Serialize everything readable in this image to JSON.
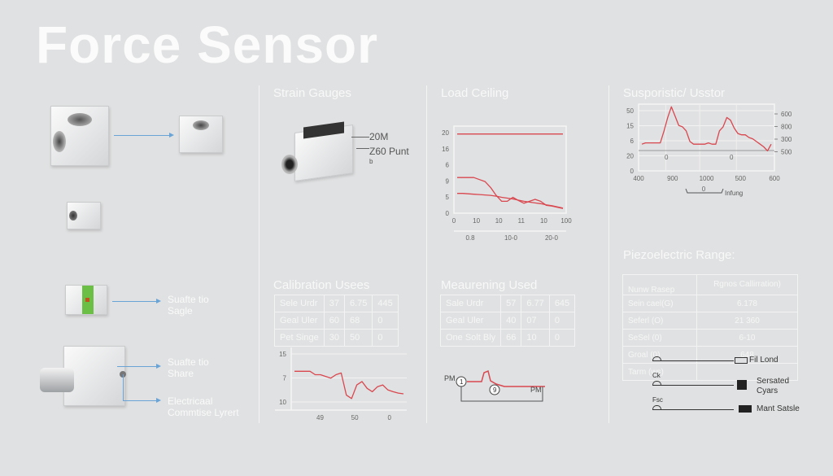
{
  "title": "Force Sensor",
  "left": {
    "callouts": [
      {
        "line1": "Suafte tio",
        "line2": "Sagle"
      },
      {
        "line1": "Suafte tio",
        "line2": "Share"
      },
      {
        "line1": "Electricaal",
        "line2": "Commtise Lyrert"
      }
    ]
  },
  "strain": {
    "heading": "Strain Gauges",
    "label_1": "20M",
    "label_2": "Z60 Punt",
    "label_3": "b"
  },
  "calibration": {
    "heading": "Calibration Usees",
    "rows": [
      [
        "Sele Urdr",
        "37",
        "6.75",
        "445"
      ],
      [
        "Geal Uler",
        "60",
        "68",
        "0"
      ],
      [
        "Pet Singe",
        "30",
        "50",
        "0"
      ]
    ]
  },
  "measuring": {
    "heading": "Meaurening Used",
    "rows": [
      [
        "Sale Urdr",
        "57",
        "6.77",
        "645"
      ],
      [
        "Geal Uler",
        "40",
        "07",
        "0"
      ],
      [
        "One Solt Bly",
        "66",
        "10",
        "0"
      ]
    ],
    "circuit": {
      "left_label": "PM",
      "right_label": "PM",
      "node_1": "1",
      "node_2": "9"
    }
  },
  "piezo": {
    "heading": "Piezoelectric Range:",
    "header": [
      "Nunw Rasep",
      "Rgnos Callirration)"
    ],
    "rows": [
      [
        "Sein cael(G)",
        "6.178"
      ],
      [
        "Seferl (O)",
        "21 360"
      ],
      [
        "SeSel (0)",
        "6-10"
      ],
      [
        "Groal (0)",
        "648"
      ],
      [
        "Tarm (ws)",
        ""
      ]
    ],
    "legend": [
      {
        "tag": "",
        "label": "Fil Lond",
        "icon": "connector-icon"
      },
      {
        "tag": "Ck",
        "label": "Sersated Cyars",
        "icon": "sensor-block-icon"
      },
      {
        "tag": "Fsc",
        "label": "Mant Satsle",
        "icon": "folder-icon"
      }
    ]
  },
  "colors": {
    "line": "#d9474f",
    "background": "#e0e1e2",
    "arrow": "#6aa3d6",
    "accent_green": "#6cbf45"
  },
  "chart_data": [
    {
      "id": "load",
      "type": "line",
      "title": "Load Ceiling",
      "ylim": [
        0,
        22
      ],
      "yticks": [
        "20",
        "16",
        "6",
        "9",
        "5",
        "0"
      ],
      "xticks": [
        "0",
        "10",
        "10",
        "11",
        "10",
        "100"
      ],
      "xticks_secondary": [
        "0.8",
        "10-0",
        "20-0"
      ],
      "grid": false,
      "series": [
        {
          "values": [
            20,
            20
          ]
        },
        {
          "values": [
            9,
            9,
            9,
            9,
            8.5,
            8,
            6.5,
            4.5,
            3,
            3,
            4,
            3.2,
            2.5,
            3,
            3.5,
            3,
            2,
            1.8,
            1.5,
            1.2
          ]
        },
        {
          "values": [
            5,
            5,
            4.9,
            4.8,
            4.7,
            4.6,
            4.5,
            4.3,
            4,
            3.8,
            3.6,
            3.3,
            3,
            2.8,
            2.6,
            2.4,
            2.1,
            1.9,
            1.6,
            1.3
          ]
        }
      ]
    },
    {
      "id": "supo",
      "type": "line",
      "title": "Susporistic/ Usstor",
      "ylim": [
        0,
        50
      ],
      "yticks": [
        "50",
        "15",
        "6",
        "20",
        "0"
      ],
      "yticks_right": [
        "600",
        "800",
        "300",
        "500"
      ],
      "xticks": [
        "400",
        "900",
        "1000",
        "500",
        "600"
      ],
      "point_labels": [
        "0",
        "0"
      ],
      "xlabel": "Infung",
      "bracket_label": "0",
      "grid": true,
      "series": [
        {
          "values": [
            20,
            21,
            21,
            21,
            21,
            21,
            30,
            40,
            48,
            41,
            34,
            33,
            30,
            22,
            20,
            20,
            20,
            20,
            21,
            20,
            20,
            30,
            33,
            40,
            38,
            32,
            28,
            27,
            27,
            25,
            24,
            22,
            20,
            18,
            15,
            20
          ]
        }
      ]
    },
    {
      "id": "calib",
      "type": "line",
      "ylim": [
        0,
        16
      ],
      "yticks": [
        "15",
        "7",
        "10"
      ],
      "xticks": [
        "49",
        "50",
        "0"
      ],
      "grid": true,
      "series": [
        {
          "values": [
            9,
            9,
            9,
            9,
            8,
            8,
            7.5,
            7,
            8,
            8.5,
            2,
            1,
            5,
            6,
            4,
            3,
            4.5,
            5,
            3.5,
            3,
            2.6,
            2.4
          ]
        }
      ]
    }
  ]
}
